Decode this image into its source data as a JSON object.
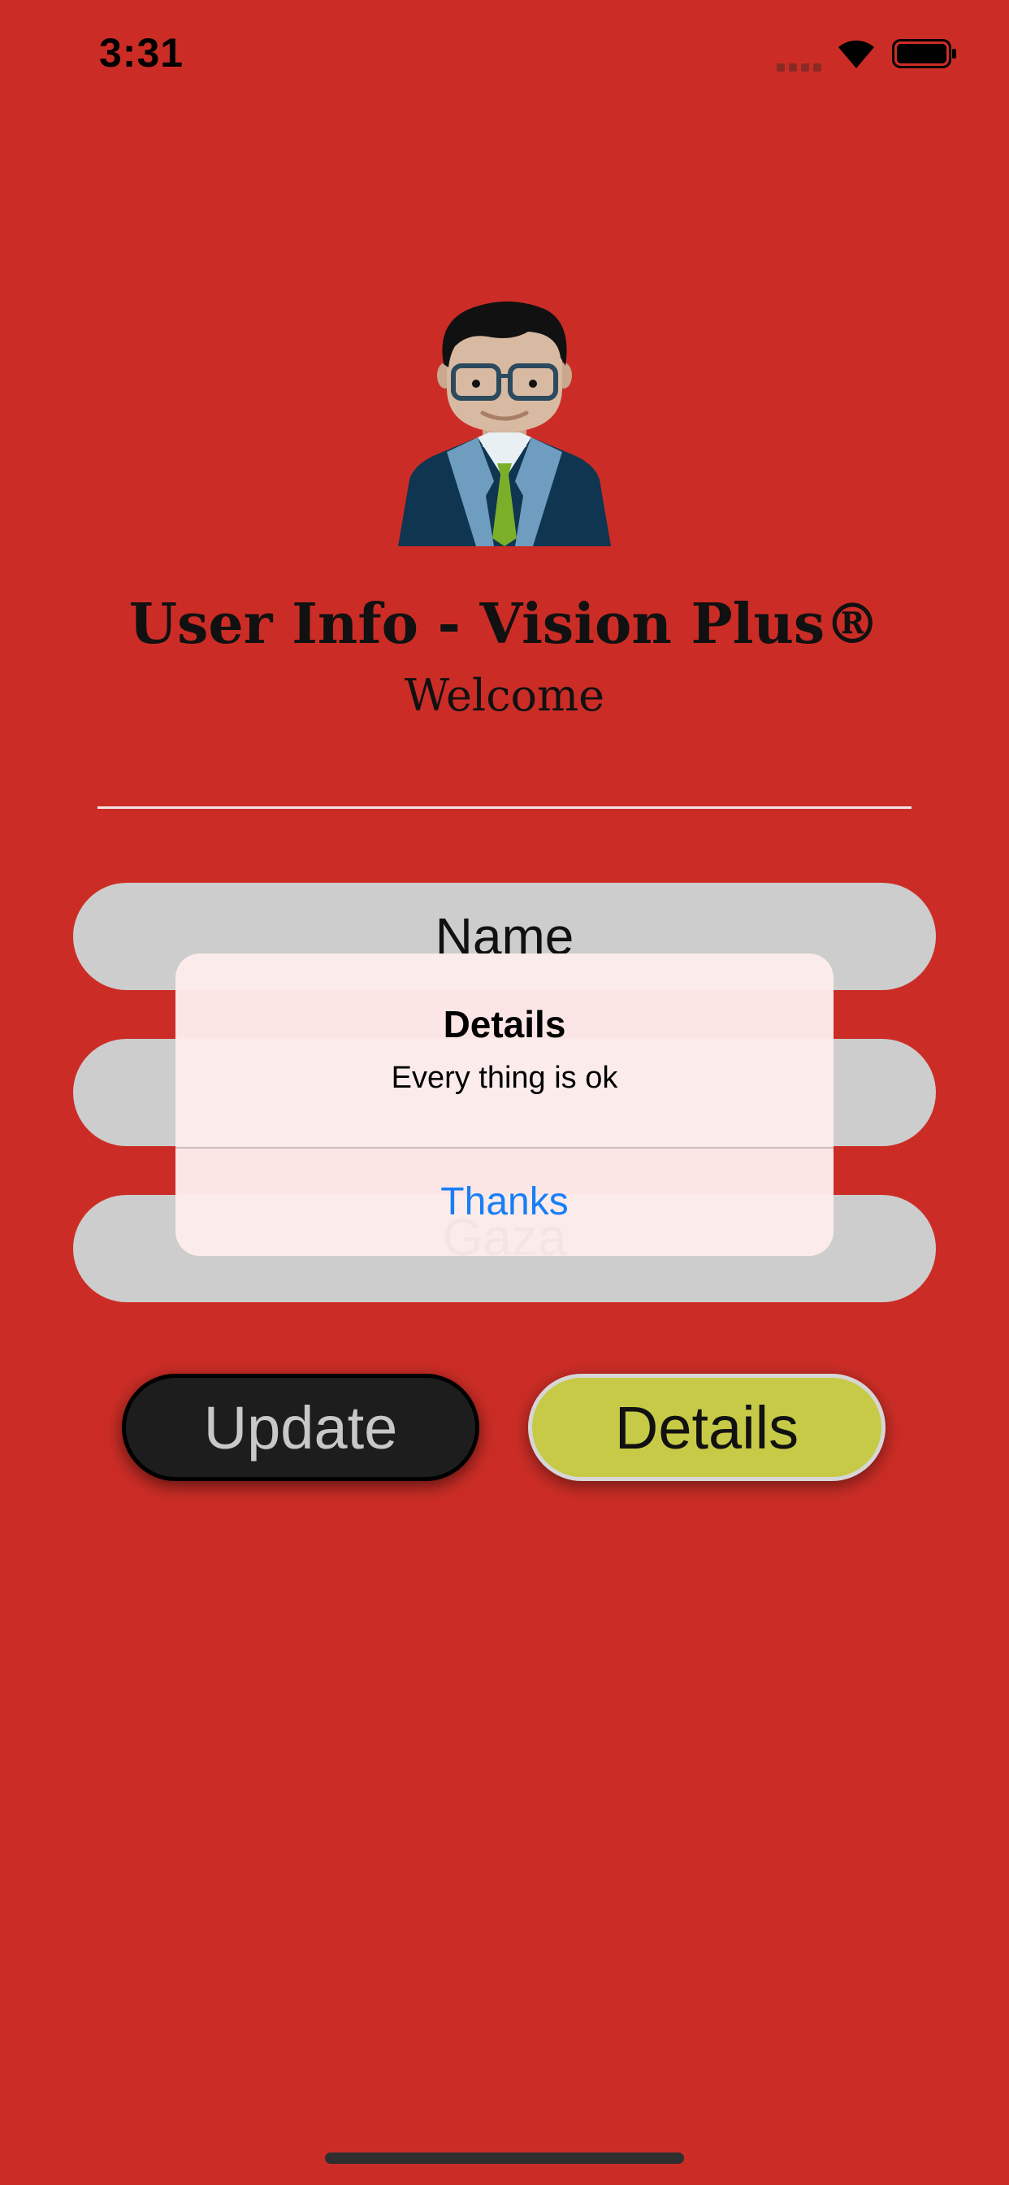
{
  "status_bar": {
    "time": "3:31"
  },
  "header": {
    "title": "User Info - Vision Plus®",
    "subtitle": "Welcome"
  },
  "form": {
    "fields": [
      {
        "value": "Name"
      },
      {
        "value": ""
      },
      {
        "value": "Gaza"
      }
    ]
  },
  "buttons": {
    "update_label": "Update",
    "details_label": "Details"
  },
  "alert": {
    "title": "Details",
    "message": "Every thing is ok",
    "action_label": "Thanks"
  },
  "colors": {
    "background": "#CB2D26",
    "field": "#CDCDCD",
    "update_button": "#1D1D1D",
    "details_button": "#C6CA46",
    "alert_action": "#1A7EF5"
  },
  "icons": [
    "cellular-signal-icon",
    "wifi-icon",
    "battery-icon",
    "user-avatar"
  ]
}
